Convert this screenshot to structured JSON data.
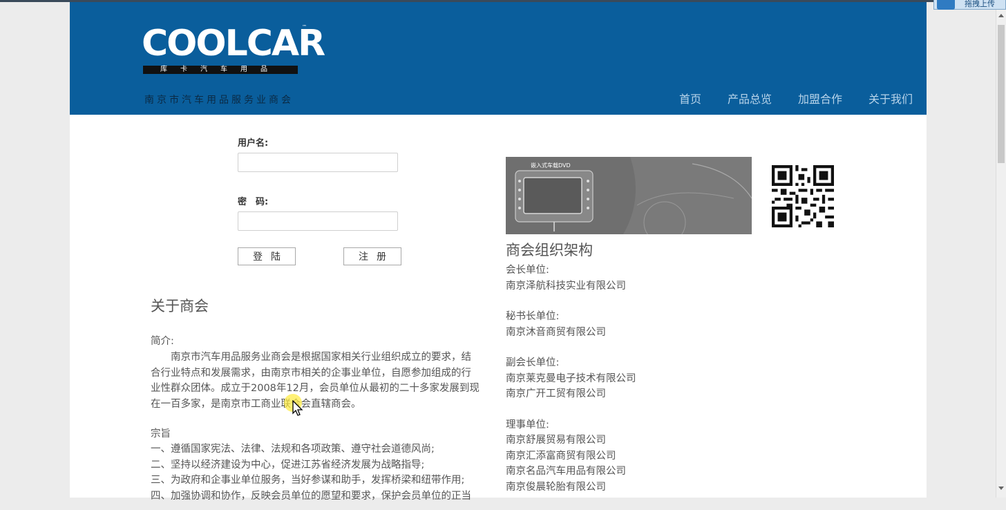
{
  "header": {
    "logo_text": "COOLCAR",
    "logo_tm": "™",
    "logo_sub": "库卡汽车用品",
    "org_name": "南京市汽车用品服务业商会"
  },
  "nav": {
    "items": [
      "首页",
      "产品总览",
      "加盟合作",
      "关于我们"
    ],
    "color": "#b8d4ea"
  },
  "login": {
    "username_label": "用户名:",
    "username_value": "",
    "password_label": "密　码:",
    "password_value": "",
    "login_button": "登陆",
    "register_button": "注册"
  },
  "about": {
    "title": "关于商会",
    "intro_label": "简介:",
    "intro_lines": [
      "　　南京市汽车用品服务业商会是根据国家相关行业组织成立的要求，结",
      "合行业特点和发展需求，由南京市相关的企事业单位，自愿参加组成的行",
      "业性群众团体。成立于2008年12月，会员单位从最初的二十多家发展到现",
      "在一百多家，是南京市工商业联合会直辖商会。"
    ],
    "purpose_label": "宗旨",
    "purpose_lines": [
      "一、遵循国家宪法、法律、法规和各项政策、遵守社会道德风尚;",
      "二、坚持以经济建设为中心，促进江苏省经济发展为战略指导;",
      "三、为政府和企事业单位服务，当好参谋和助手，发挥桥梁和纽带作用;",
      "四、加强协调和协作，反映会员单位的愿望和要求，保护会员单位的正当"
    ]
  },
  "banner": {
    "caption": "嵌入式车载DVD"
  },
  "org": {
    "title": "商会组织架构",
    "groups": [
      {
        "label": "会长单位:",
        "members": [
          "南京泽航科技实业有限公司"
        ]
      },
      {
        "label": "秘书长单位:",
        "members": [
          "南京沐音商贸有限公司"
        ]
      },
      {
        "label": "副会长单位:",
        "members": [
          "南京莱克曼电子技术有限公司",
          "南京广开工贸有限公司"
        ]
      },
      {
        "label": "理事单位:",
        "members": [
          "南京舒展贸易有限公司",
          "南京汇添富商贸有限公司",
          "南京名品汽车用品有限公司",
          "南京俊晨轮胎有限公司"
        ]
      }
    ]
  },
  "browser": {
    "upload_label": "拖拽上传"
  },
  "colors": {
    "header_bg": "#0a5e9c",
    "page_bg": "#ffffff",
    "outer_bg": "#ececec"
  }
}
